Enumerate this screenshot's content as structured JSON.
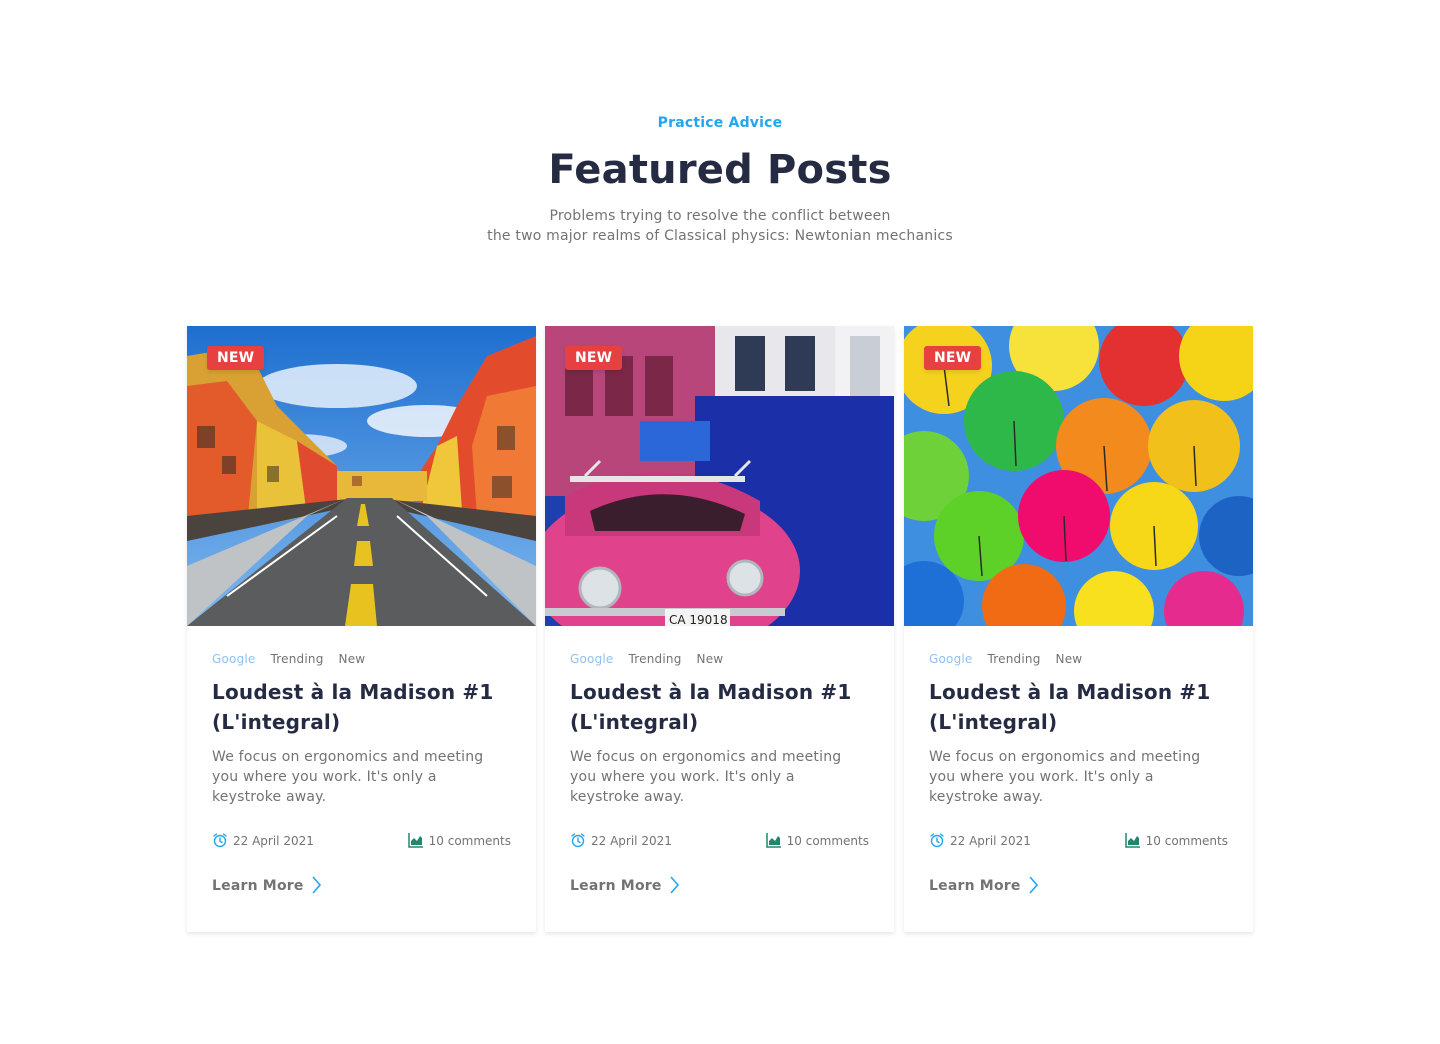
{
  "section": {
    "eyebrow": "Practice Advice",
    "title": "Featured Posts",
    "subtitle_line1": "Problems trying to resolve the conflict between",
    "subtitle_line2": "the two major realms of Classical physics: Newtonian mechanics"
  },
  "colors": {
    "primary": "#23A6F0",
    "heading": "#252B42",
    "muted": "#737373",
    "badge": "#E74040",
    "tag_highlight": "#8EC2F2",
    "icon_green": "#23856D"
  },
  "posts": [
    {
      "badge": "NEW",
      "image": "colorful-street-houses",
      "tags": [
        "Google",
        "Trending",
        "New"
      ],
      "title": "Loudest à la Madison #1 (L'integral)",
      "excerpt": "We focus on ergonomics and meeting you where you work. It's only a keystroke away.",
      "date": "22 April 2021",
      "comments": "10 comments",
      "cta": "Learn More"
    },
    {
      "badge": "NEW",
      "image": "pink-beetle-car",
      "tags": [
        "Google",
        "Trending",
        "New"
      ],
      "title": "Loudest à la Madison #1 (L'integral)",
      "excerpt": "We focus on ergonomics and meeting you where you work. It's only a keystroke away.",
      "date": "22 April 2021",
      "comments": "10 comments",
      "cta": "Learn More"
    },
    {
      "badge": "NEW",
      "image": "colorful-umbrellas",
      "tags": [
        "Google",
        "Trending",
        "New"
      ],
      "title": "Loudest à la Madison #1 (L'integral)",
      "excerpt": "We focus on ergonomics and meeting you where you work. It's only a keystroke away.",
      "date": "22 April 2021",
      "comments": "10 comments",
      "cta": "Learn More"
    }
  ]
}
